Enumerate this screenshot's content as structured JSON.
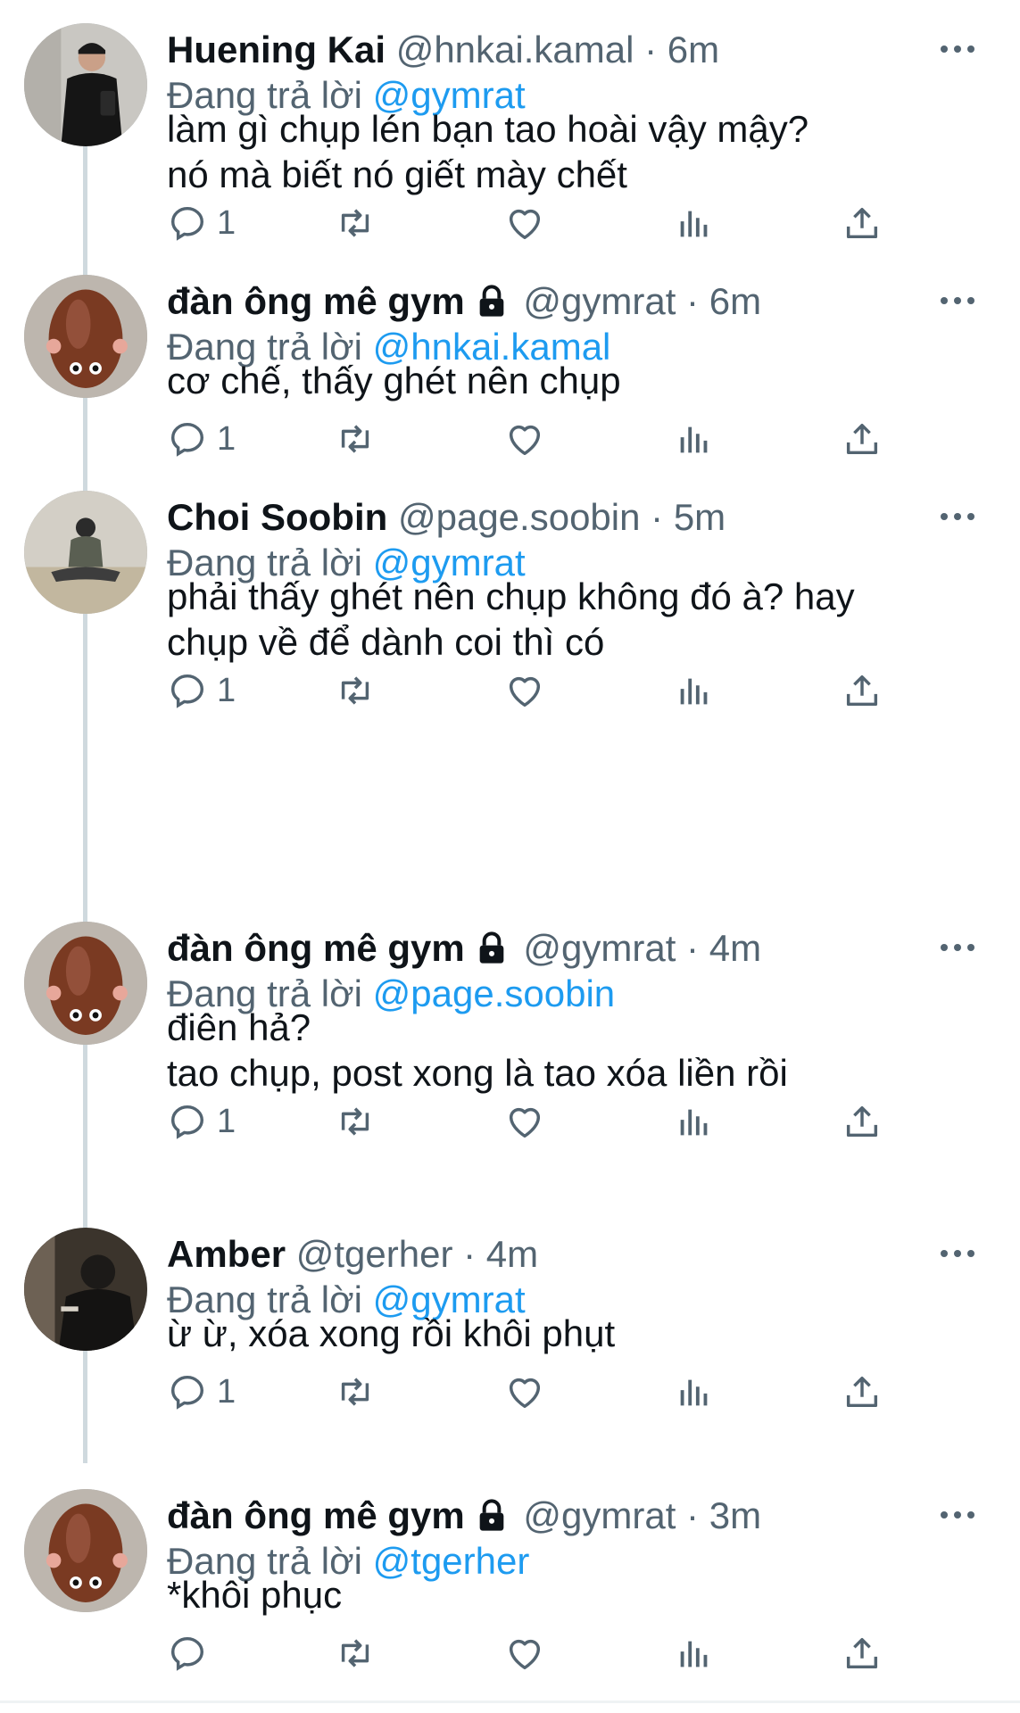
{
  "reply_prefix": "Đang trả lời",
  "tweets": [
    {
      "name": "Huening Kai",
      "handle": "@hnkai.kamal",
      "dot": "·",
      "time": "6m",
      "reply_to": "@gymrat",
      "text": "làm gì chụp lén bạn tao hoài vậy mậy?\nnó mà biết nó giết mày chết",
      "reply_count": "1",
      "locked": false,
      "avatar_icon": "person-mirror-selfie-avatar"
    },
    {
      "name": "đàn ông mê gym",
      "handle": "@gymrat",
      "dot": "·",
      "time": "6m",
      "reply_to": "@hnkai.kamal",
      "text": "cơ chế, thấy ghét nên chụp",
      "reply_count": "1",
      "locked": true,
      "avatar_icon": "chocolate-mouse-avatar"
    },
    {
      "name": "Choi Soobin",
      "handle": "@page.soobin",
      "dot": "·",
      "time": "5m",
      "reply_to": "@gymrat",
      "text": "phải thấy ghét nên chụp không đó à? hay\nchụp về để dành coi thì có",
      "reply_count": "1",
      "locked": false,
      "avatar_icon": "person-sitting-floor-avatar"
    },
    {
      "name": "đàn ông mê gym",
      "handle": "@gymrat",
      "dot": "·",
      "time": "4m",
      "reply_to": "@page.soobin",
      "text": "điên hả?\ntao chụp, post xong là tao xóa liền rồi",
      "reply_count": "1",
      "locked": true,
      "avatar_icon": "chocolate-mouse-avatar"
    },
    {
      "name": "Amber",
      "handle": "@tgerher",
      "dot": "·",
      "time": "4m",
      "reply_to": "@gymrat",
      "text": "ừ ừ, xóa xong rồi khôi phụt",
      "reply_count": "1",
      "locked": false,
      "avatar_icon": "dark-portrait-avatar"
    },
    {
      "name": "đàn ông mê gym",
      "handle": "@gymrat",
      "dot": "·",
      "time": "3m",
      "reply_to": "@tgerher",
      "text": "*khôi phục",
      "reply_count": "",
      "locked": true,
      "avatar_icon": "chocolate-mouse-avatar"
    }
  ],
  "colors": {
    "link": "#1d9bf0",
    "secondary_text": "#536471",
    "primary_text": "#0f1419",
    "thread_line": "#cfd9de"
  }
}
